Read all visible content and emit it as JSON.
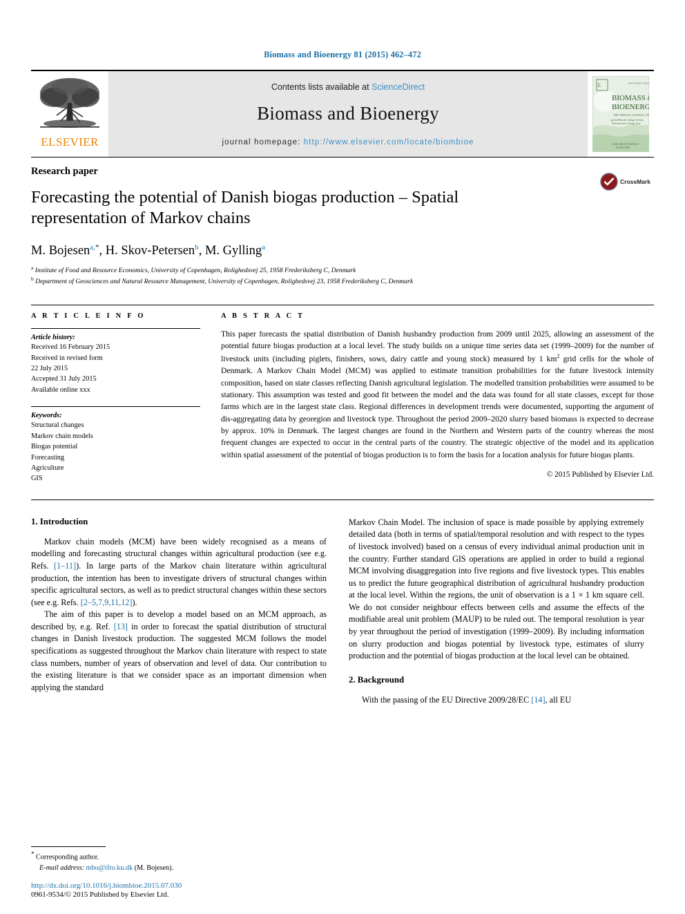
{
  "running_head": "Biomass and Bioenergy 81 (2015) 462–472",
  "masthead": {
    "publisher": "ELSEVIER",
    "contents_prefix": "Contents lists available at ",
    "contents_link": "ScienceDirect",
    "journal_title": "Biomass and Bioenergy",
    "homepage_label": "journal homepage: ",
    "homepage_url": "http://www.elsevier.com/locate/biombioe",
    "cover_title_line1": "BIOMASS &",
    "cover_title_line2": "BIOENERGY",
    "cover_publisher": "ELSEVIER"
  },
  "article": {
    "kind": "Research paper",
    "title": "Forecasting the potential of Danish biogas production – Spatial representation of Markov chains",
    "authors": [
      {
        "name": "M. Bojesen",
        "marks": "a,*"
      },
      {
        "name": "H. Skov-Petersen",
        "marks": "b"
      },
      {
        "name": "M. Gylling",
        "marks": "a"
      }
    ],
    "authors_line": "M. Bojesen a,*, H. Skov-Petersen b, M. Gylling a",
    "affiliations": [
      {
        "mark": "a",
        "text": "Institute of Food and Resource Economics, University of Copenhagen, Rolighedsvej 25, 1958 Frederiksberg C, Denmark"
      },
      {
        "mark": "b",
        "text": "Department of Geosciences and Natural Resource Management, University of Copenhagen, Rolighedsvej 23, 1958 Frederiksberg C, Denmark"
      }
    ],
    "crossmark_label": "CrossMark"
  },
  "article_info": {
    "section_label": "A R T I C L E   I N F O",
    "history_head": "Article history:",
    "history": [
      "Received 16 February 2015",
      "Received in revised form",
      "22 July 2015",
      "Accepted 31 July 2015",
      "Available online xxx"
    ],
    "keywords_head": "Keywords:",
    "keywords": [
      "Structural changes",
      "Markov chain models",
      "Biogas potential",
      "Forecasting",
      "Agriculture",
      "GIS"
    ]
  },
  "abstract": {
    "section_label": "A B S T R A C T",
    "text_part1": "This paper forecasts the spatial distribution of Danish husbandry production from 2009 until 2025, allowing an assessment of the potential future biogas production at a local level. The study builds on a unique time series data set (1999–2009) for the number of livestock units (including piglets, finishers, sows, dairy cattle and young stock) measured by 1 km",
    "text_sup": "2",
    "text_part2": " grid cells for the whole of Denmark. A Markov Chain Model (MCM) was applied to estimate transition probabilities for the future livestock intensity composition, based on state classes reflecting Danish agricultural legislation. The modelled transition probabilities were assumed to be stationary. This assumption was tested and good fit between the model and the data was found for all state classes, except for those farms which are in the largest state class. Regional differences in development trends were documented, supporting the argument of dis-aggregating data by georegion and livestock type. Throughout the period 2009–2020 slurry based biomass is expected to decrease by approx. 10% in Denmark. The largest changes are found in the Northern and Western parts of the country whereas the most frequent changes are expected to occur in the central parts of the country. The strategic objective of the model and its application within spatial assessment of the potential of biogas production is to form the basis for a location analysis for future biogas plants.",
    "copyright": "© 2015 Published by Elsevier Ltd."
  },
  "body": {
    "left": {
      "heading": "1.  Introduction",
      "para1_a": "Markov chain models (MCM) have been widely recognised as a means of modelling and forecasting structural changes within agricultural production (see e.g. Refs. ",
      "para1_ref1": "[1–11]",
      "para1_b": "). In large parts of the Markov chain literature within agricultural production, the intention has been to investigate drivers of structural changes within specific agricultural sectors, as well as to predict structural changes within these sectors (see e.g. Refs. ",
      "para1_ref2": "[2–5,7,9,11,12]",
      "para1_c": ").",
      "para2_a": "The aim of this paper is to develop a model based on an MCM approach, as described by, e.g. Ref. ",
      "para2_ref": "[13]",
      "para2_b": " in order to forecast the spatial distribution of structural changes in Danish livestock production. The suggested MCM follows the model specifications as suggested throughout the Markov chain literature with respect to state class numbers, number of years of observation and level of data. Our contribution to the existing literature is that we consider space as an important dimension when applying the standard"
    },
    "right": {
      "para_cont": "Markov Chain Model. The inclusion of space is made possible by applying extremely detailed data (both in terms of spatial/temporal resolution and with respect to the types of livestock involved) based on a census of every individual animal production unit in the country. Further standard GIS operations are applied in order to build a regional MCM involving disaggregation into five regions and five livestock types. This enables us to predict the future geographical distribution of agricultural husbandry production at the local level. Within the regions, the unit of observation is a 1 × 1 km square cell. We do not consider neighbour effects between cells and assume the effects of the modifiable areal unit problem (MAUP) to be ruled out. The temporal resolution is year by year throughout the period of investigation (1999–2009). By including information on slurry production and biogas potential by livestock type, estimates of slurry production and the potential of biogas production at the local level can be obtained.",
      "heading2": "2.  Background",
      "para2_a": "With the passing of the EU Directive 2009/28/EC ",
      "para2_ref": "[14]",
      "para2_b": ", all EU"
    }
  },
  "footer": {
    "corresponding_star": "*",
    "corresponding": " Corresponding author.",
    "email_label": "E-mail address:",
    "email": "mbo@ifro.ku.dk",
    "email_suffix": " (M. Bojesen).",
    "doi": "http://dx.doi.org/10.1016/j.biombioe.2015.07.030",
    "issn_line": "0961-9534/© 2015 Published by Elsevier Ltd."
  },
  "colors": {
    "link_blue": "#1a6fa8",
    "sciencedirect_blue": "#3d8fc4",
    "elsevier_orange": "#f08100",
    "masthead_gray": "#e6e6e6",
    "crossmark_red": "#8b1a1a"
  }
}
